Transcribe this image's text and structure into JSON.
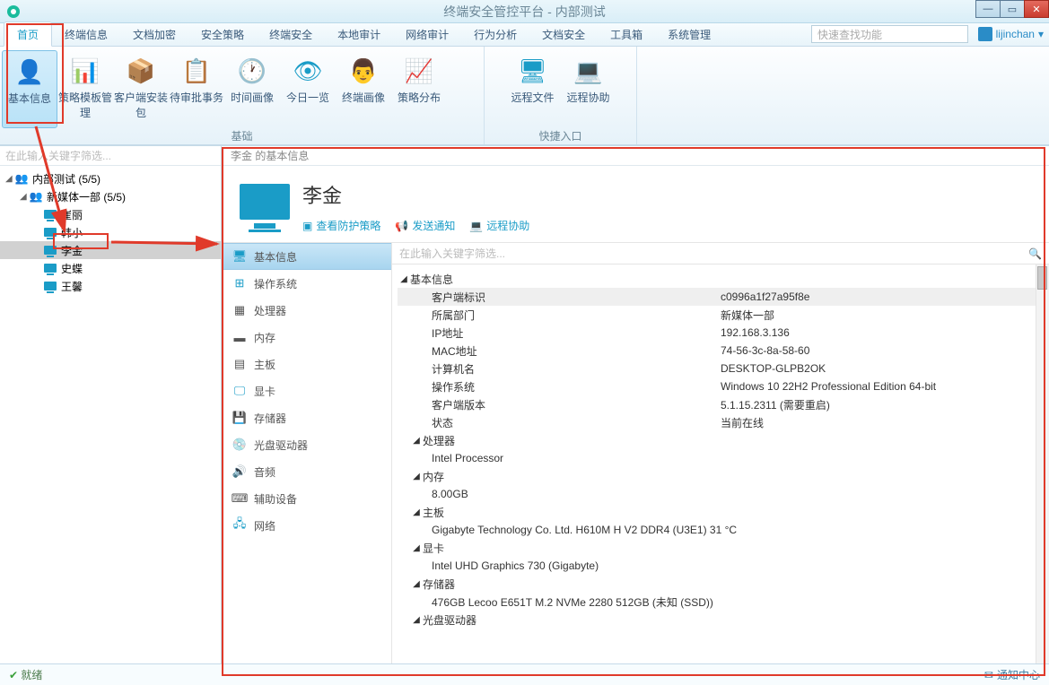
{
  "window": {
    "title": "终端安全管控平台 - 内部测试"
  },
  "tabs": [
    "首页",
    "终端信息",
    "文档加密",
    "安全策略",
    "终端安全",
    "本地审计",
    "网络审计",
    "行为分析",
    "文档安全",
    "工具箱",
    "系统管理"
  ],
  "search_placeholder": "快速查找功能",
  "user": "lijinchan",
  "ribbon": {
    "groups": [
      {
        "caption": "基础",
        "items": [
          "基本信息",
          "策略模板管理",
          "客户端安装包",
          "待审批事务",
          "时间画像",
          "今日一览",
          "终端画像",
          "策略分布"
        ]
      },
      {
        "caption": "快捷入口",
        "items": [
          "远程文件",
          "远程协助"
        ]
      }
    ]
  },
  "tree_filter_placeholder": "在此输入关键字筛选...",
  "tree": {
    "root": {
      "label": "内部测试 (5/5)"
    },
    "dept": {
      "label": "新媒体一部 (5/5)"
    },
    "members": [
      "崔丽",
      "韩小",
      "李金",
      "史蝶",
      "王馨"
    ]
  },
  "breadcrumb": "李金 的基本信息",
  "subject": {
    "name": "李金",
    "links": [
      "查看防护策略",
      "发送通知",
      "远程协助"
    ]
  },
  "categories": [
    "基本信息",
    "操作系统",
    "处理器",
    "内存",
    "主板",
    "显卡",
    "存储器",
    "光盘驱动器",
    "音频",
    "辅助设备",
    "网络"
  ],
  "info_filter_placeholder": "在此输入关键字筛选...",
  "info": {
    "g_basic": "基本信息",
    "rows": [
      {
        "k": "客户端标识",
        "v": "c0996a1f27a95f8e",
        "hl": true
      },
      {
        "k": "所属部门",
        "v": "新媒体一部"
      },
      {
        "k": "IP地址",
        "v": "192.168.3.136"
      },
      {
        "k": "MAC地址",
        "v": "74-56-3c-8a-58-60"
      },
      {
        "k": "计算机名",
        "v": "DESKTOP-GLPB2OK"
      },
      {
        "k": "操作系统",
        "v": "Windows 10 22H2 Professional Edition 64-bit"
      },
      {
        "k": "客户端版本",
        "v": "5.1.15.2311 (需要重启)"
      },
      {
        "k": "状态",
        "v": "当前在线"
      }
    ],
    "g_cpu": "处理器",
    "cpu": "Intel Processor",
    "g_mem": "内存",
    "mem": "8.00GB",
    "g_mb": "主板",
    "mb": "Gigabyte Technology Co. Ltd. H610M H V2 DDR4 (U3E1)   31 °C",
    "g_gpu": "显卡",
    "gpu": "Intel UHD Graphics 730 (Gigabyte)",
    "g_disk": "存储器",
    "disk": "476GB Lecoo E651T M.2 NVMe 2280 512GB (未知 (SSD))",
    "g_odd": "光盘驱动器"
  },
  "status": {
    "ok": "就绪",
    "notif": "通知中心"
  }
}
